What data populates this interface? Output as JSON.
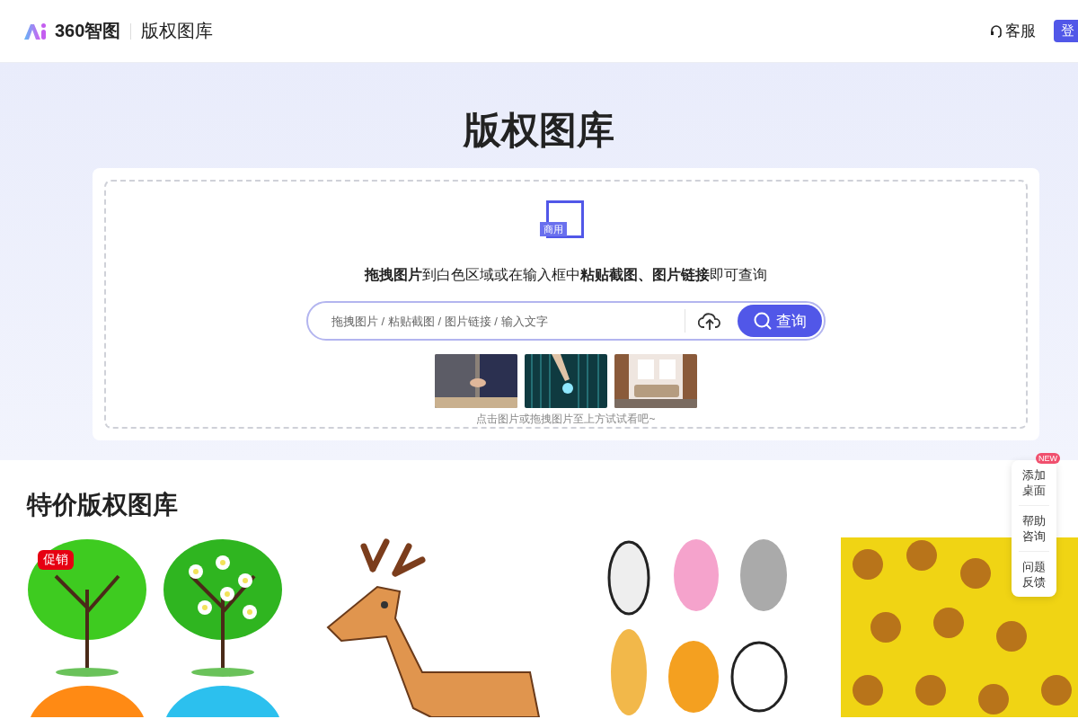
{
  "header": {
    "logo_text": "360智图",
    "product": "版权图库",
    "service_link": "客服",
    "login_button": "登"
  },
  "hero": {
    "title": "版权图库",
    "badge": "商用",
    "instruction": "**拖拽图片**到白色区域或在输入框中**粘贴截图、图片链接**即可查询",
    "search": {
      "placeholder": "拖拽图片 / 粘贴截图 / 图片链接 / 输入文字",
      "button": "查询"
    },
    "samples": [
      {
        "kind": "handshake"
      },
      {
        "kind": "digital"
      },
      {
        "kind": "room"
      }
    ],
    "hint": "点击图片或拖拽图片至上方试试看吧~"
  },
  "section": {
    "title": "特价版权图库",
    "items": [
      {
        "kind": "trees",
        "tag": "促销"
      },
      {
        "kind": "deer"
      },
      {
        "kind": "animals"
      },
      {
        "kind": "sunflowers"
      }
    ]
  },
  "float_panel": {
    "badge": "NEW",
    "items": [
      "添加桌面",
      "帮助咨询",
      "问题反馈"
    ]
  }
}
